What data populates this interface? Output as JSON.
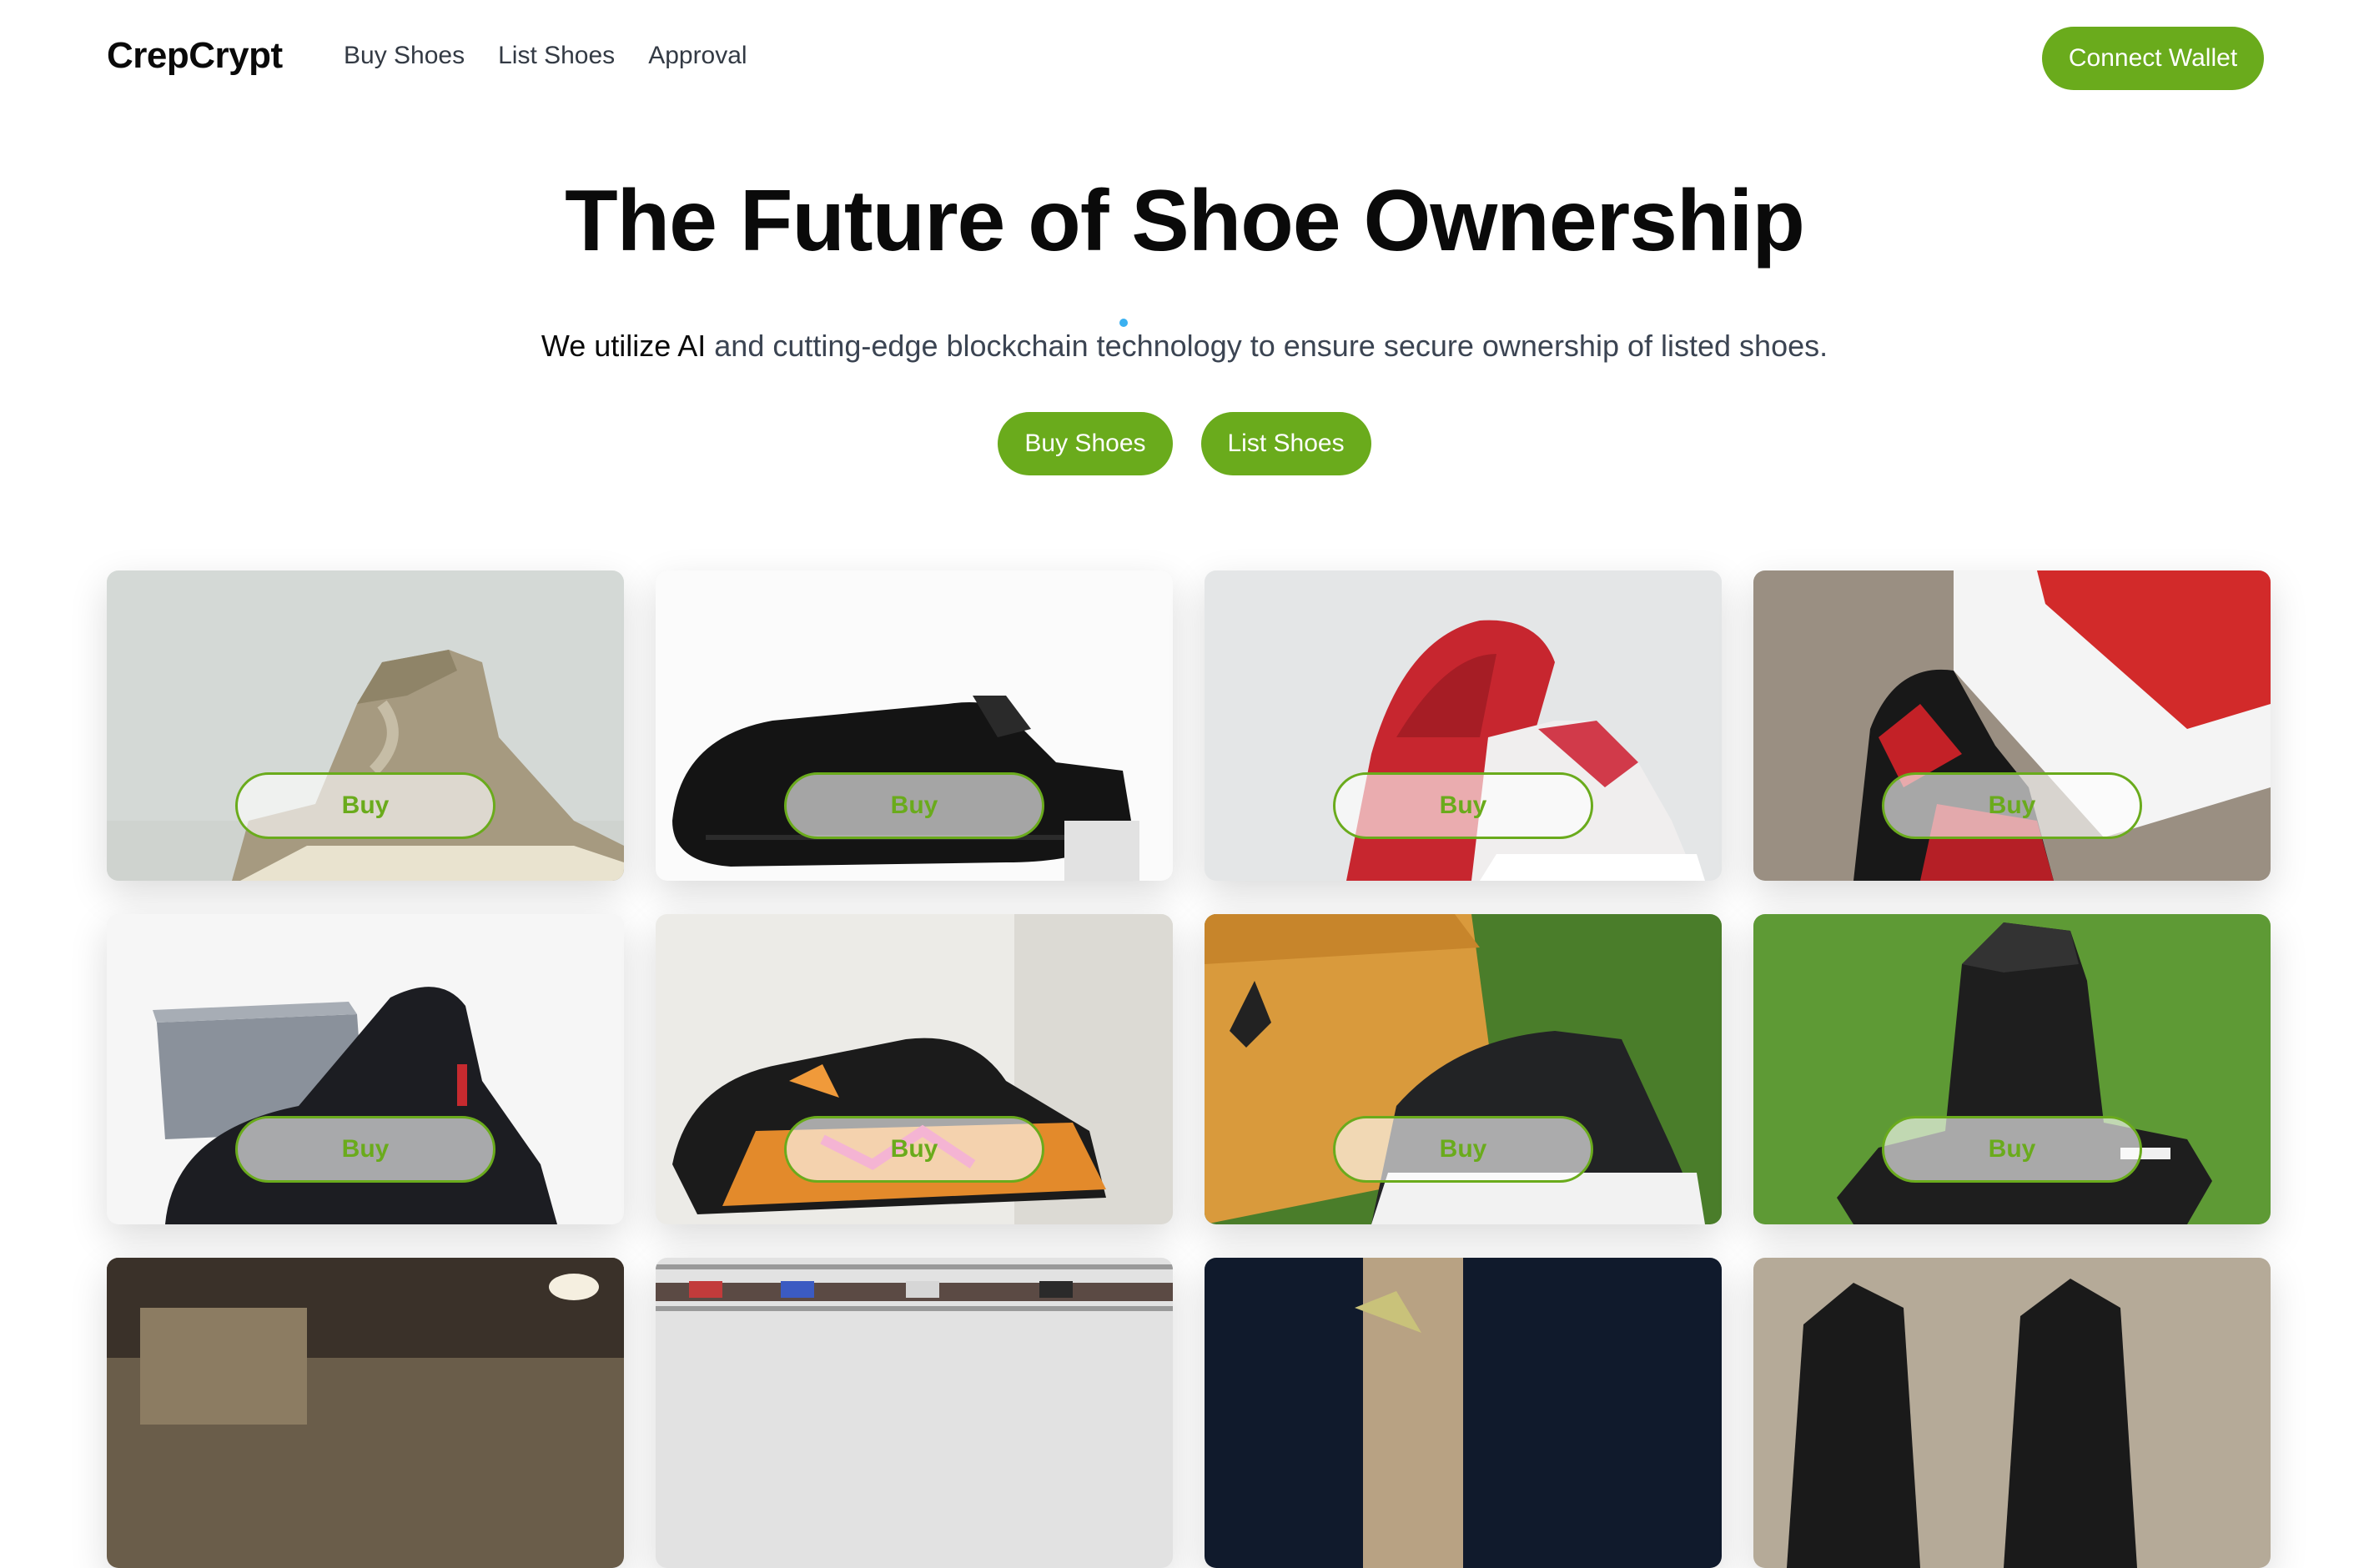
{
  "brand": {
    "name": "CrepCrypt"
  },
  "nav": {
    "links": [
      "Buy Shoes",
      "List Shoes",
      "Approval"
    ],
    "connect_label": "Connect Wallet"
  },
  "hero": {
    "title": "The Future of Shoe Ownership",
    "subtitle_lead": "We utilize AI",
    "subtitle_rest": " and cutting-edge blockchain technology to ensure secure ownership of listed shoes.",
    "buttons": [
      "Buy Shoes",
      "List Shoes"
    ]
  },
  "listings": [
    {
      "buy_label": "Buy",
      "image": "tan-high-top-sneaker-photo"
    },
    {
      "buy_label": "Buy",
      "image": "black-slip-on-shoe-photo"
    },
    {
      "buy_label": "Buy",
      "image": "red-white-high-top-sneaker-photo"
    },
    {
      "buy_label": "Buy",
      "image": "red-black-sneaker-with-box-photo"
    },
    {
      "buy_label": "Buy",
      "image": "black-sneaker-with-grey-box-photo"
    },
    {
      "buy_label": "Buy",
      "image": "butterfly-pattern-sneaker-photo"
    },
    {
      "buy_label": "Buy",
      "image": "black-white-sneaker-with-box-photo"
    },
    {
      "buy_label": "Buy",
      "image": "black-high-top-on-grass-photo"
    },
    {
      "buy_label": null,
      "image": "warehouse-photo"
    },
    {
      "buy_label": null,
      "image": "shoe-shelf-photo"
    },
    {
      "buy_label": null,
      "image": "dark-box-photo"
    },
    {
      "buy_label": null,
      "image": "black-shoes-on-gravel-photo"
    }
  ],
  "colors": {
    "accent": "#6aab1c",
    "loading_dot": "#3ab0f0"
  }
}
